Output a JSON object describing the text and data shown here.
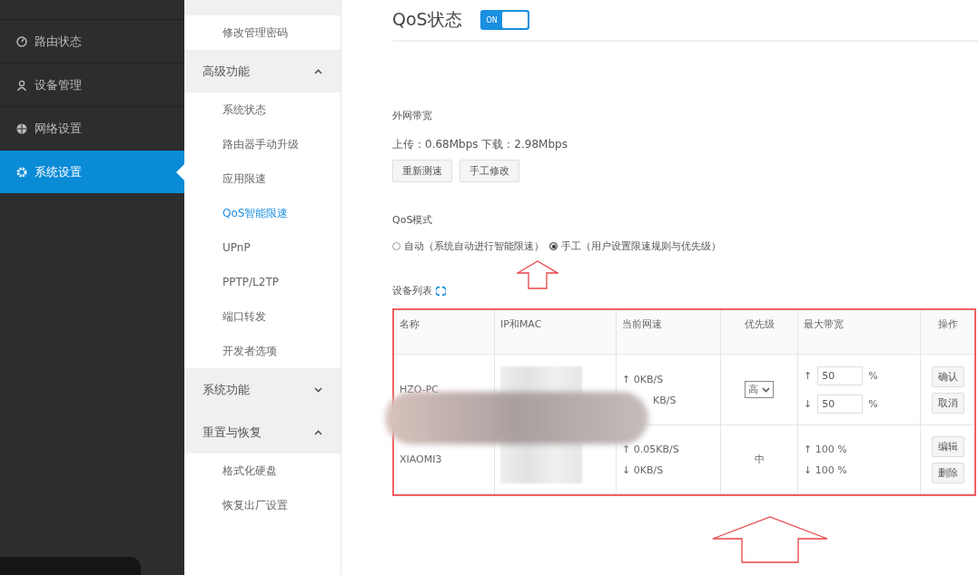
{
  "sidebar": {
    "items": [
      {
        "label": "路由状态",
        "selected": false
      },
      {
        "label": "设备管理",
        "selected": false
      },
      {
        "label": "网络设置",
        "selected": false
      },
      {
        "label": "系统设置",
        "selected": true
      }
    ]
  },
  "sub_nav": {
    "groups": [
      {
        "children": [
          {
            "label": "修改管理密码",
            "selected": false
          }
        ]
      },
      {
        "label": "高级功能",
        "expanded": true,
        "children": [
          {
            "label": "系统状态",
            "selected": false
          },
          {
            "label": "路由器手动升级",
            "selected": false
          },
          {
            "label": "应用限速",
            "selected": false
          },
          {
            "label": "QoS智能限速",
            "selected": true
          },
          {
            "label": "UPnP",
            "selected": false
          },
          {
            "label": "PPTP/L2TP",
            "selected": false
          },
          {
            "label": "端口转发",
            "selected": false
          },
          {
            "label": "开发者选项",
            "selected": false
          }
        ]
      },
      {
        "label": "系统功能",
        "expanded": false
      },
      {
        "label": "重置与恢复",
        "expanded": true,
        "children": [
          {
            "label": "格式化硬盘",
            "selected": false
          },
          {
            "label": "恢复出厂设置",
            "selected": false
          }
        ]
      }
    ]
  },
  "qos_status": {
    "title": "QoS状态",
    "toggle_label": "ON",
    "on": true
  },
  "bandwidth": {
    "heading": "外网带宽",
    "reading": "上传：0.68Mbps 下载：2.98Mbps",
    "buttons": [
      "重新测速",
      "手工修改"
    ]
  },
  "qos_mode": {
    "heading": "QoS模式",
    "options": [
      {
        "label": "自动（系统自动进行智能限速）",
        "selected": false
      },
      {
        "label": "手工（用户设置限速规则与优先级）",
        "selected": true
      }
    ]
  },
  "device_list": {
    "heading": "设备列表",
    "columns": [
      "名称",
      "IP和MAC",
      "当前网速",
      "优先级",
      "最大带宽",
      "操作"
    ],
    "rows": [
      {
        "kind": "editing",
        "name": "HZO-PC",
        "rate_up": "↑ 0KB/S",
        "rate_down": "KB/S",
        "priority": "高",
        "arrow_up": "↑",
        "arrow_down": "↓",
        "max_up": "50",
        "max_down": "50",
        "unit": "%",
        "actions": [
          "确认",
          "取消"
        ]
      },
      {
        "kind": "static",
        "name": "XIAOMI3",
        "rate_up": "↑ 0.05KB/S",
        "rate_down": "↓ 0KB/S",
        "priority": "中",
        "max_up": "↑ 100 %",
        "max_down": "↓ 100 %",
        "actions": [
          "编辑",
          "删除"
        ]
      }
    ]
  }
}
